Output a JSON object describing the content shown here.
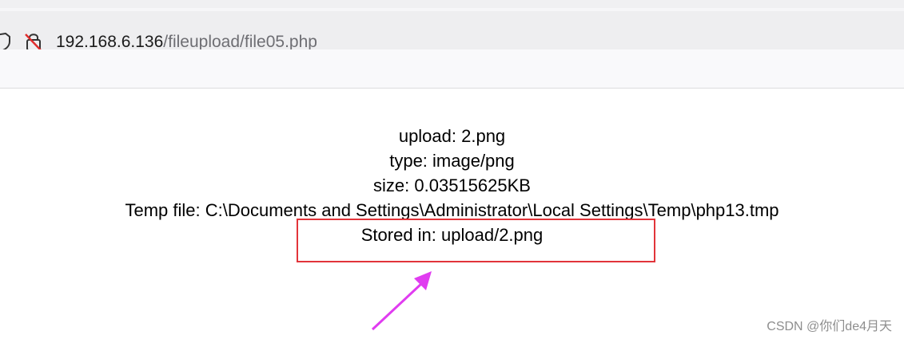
{
  "browser": {
    "url_host": "192.168.6.136",
    "url_path": "/fileupload/file05.php"
  },
  "page": {
    "lines": [
      "upload: 2.png",
      "type: image/png",
      "size: 0.03515625KB",
      "Temp file: C:\\Documents and Settings\\Administrator\\Local Settings\\Temp\\php13.tmp",
      "Stored in: upload/2.png"
    ]
  },
  "annotation": {
    "box_color": "#e2343a",
    "arrow_color": "#e03cf0"
  },
  "watermark": "CSDN @你们de4月天"
}
